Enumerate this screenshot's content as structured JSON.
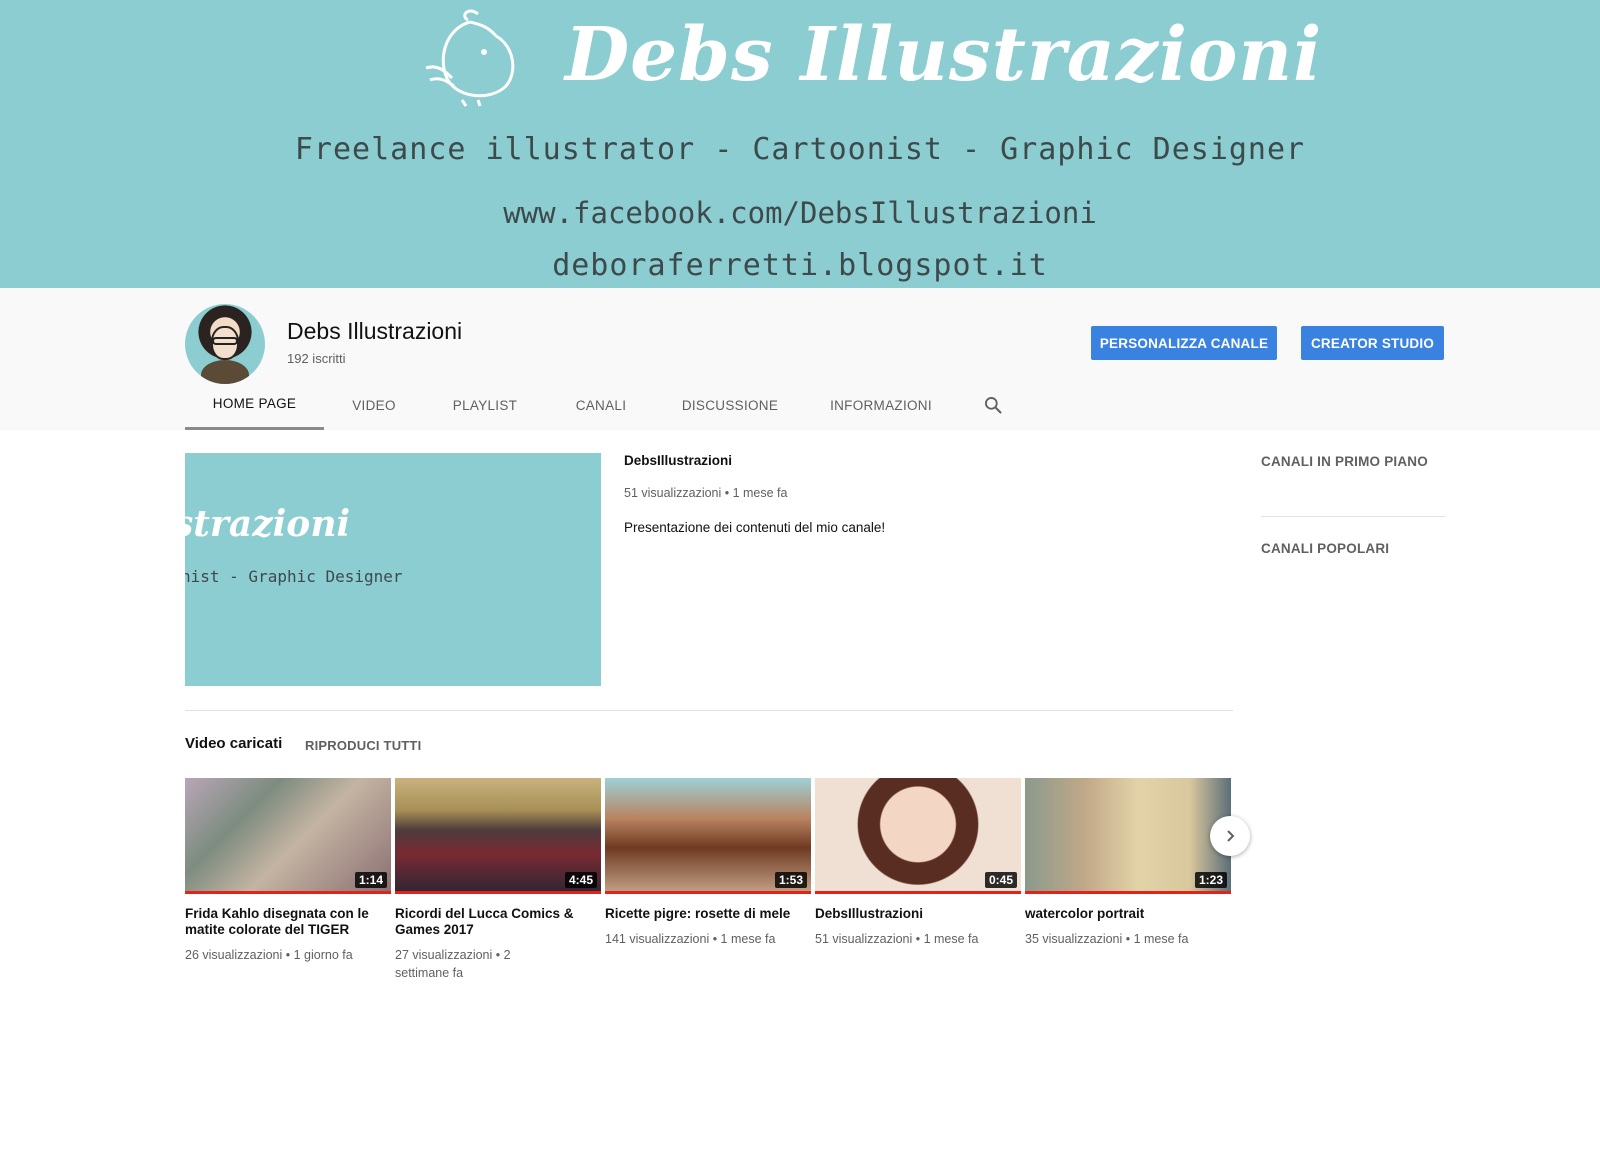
{
  "banner": {
    "title": "Debs Illustrazioni",
    "tagline": "Freelance illustrator - Cartoonist - Graphic Designer",
    "facebook": "www.facebook.com/DebsIllustrazioni",
    "blog": "deboraferretti.blogspot.it",
    "background_color": "#8ccdd1"
  },
  "channel": {
    "name": "Debs Illustrazioni",
    "subscribers": "192 iscritti"
  },
  "buttons": {
    "customize": "PERSONALIZZA CANALE",
    "studio": "CREATOR STUDIO",
    "color": "#3a82e0"
  },
  "tabs": [
    {
      "label": "HOME PAGE",
      "active": true
    },
    {
      "label": "VIDEO"
    },
    {
      "label": "PLAYLIST"
    },
    {
      "label": "CANALI"
    },
    {
      "label": "DISCUSSIONE"
    },
    {
      "label": "INFORMAZIONI"
    }
  ],
  "featured": {
    "thumb_text1": "strazioni",
    "thumb_text2": "nist - Graphic Designer",
    "title": "DebsIllustrazioni",
    "meta": "51 visualizzazioni • 1 mese fa",
    "description": "Presentazione dei contenuti del mio canale!"
  },
  "sidebar": {
    "featured_channels": "CANALI IN PRIMO PIANO",
    "popular_channels": "CANALI POPOLARI"
  },
  "uploads": {
    "title": "Video caricati",
    "play_all": "RIPRODUCI TUTTI",
    "videos": [
      {
        "title": "Frida Kahlo disegnata con le matite colorate del TIGER",
        "duration": "1:14",
        "meta": "26 visualizzazioni • 1 giorno fa"
      },
      {
        "title": "Ricordi del Lucca Comics & Games 2017",
        "duration": "4:45",
        "meta": "27 visualizzazioni • 2 settimane fa"
      },
      {
        "title": "Ricette pigre: rosette di mele",
        "duration": "1:53",
        "meta": "141 visualizzazioni • 1 mese fa"
      },
      {
        "title": "DebsIllustrazioni",
        "duration": "0:45",
        "meta": "51 visualizzazioni • 1 mese fa"
      },
      {
        "title": "watercolor portrait",
        "duration": "1:23",
        "meta": "35 visualizzazioni • 1 mese fa"
      }
    ]
  },
  "icons": {
    "search": "search-icon",
    "next": "chevron-right-icon"
  }
}
